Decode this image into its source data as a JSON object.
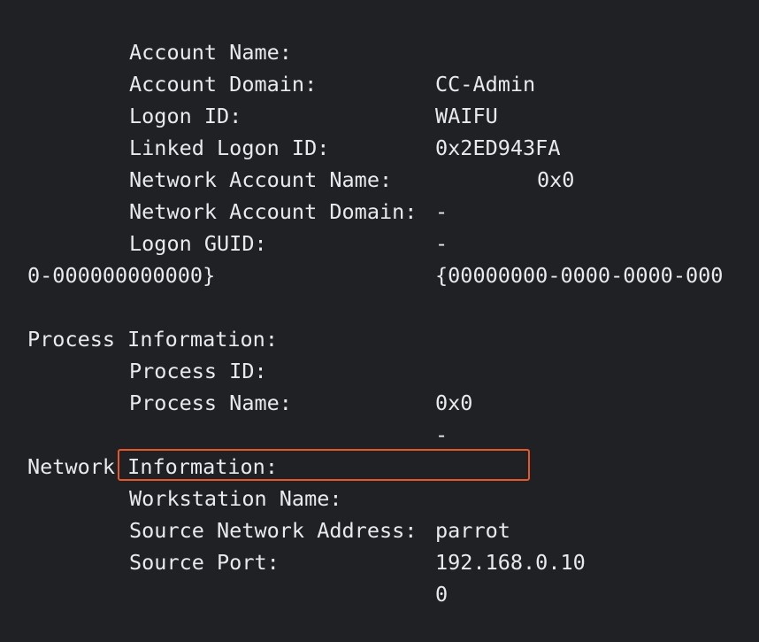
{
  "log": {
    "account_name": {
      "key": "Account Name:",
      "value": "CC-Admin"
    },
    "account_domain": {
      "key": "Account Domain:",
      "value": "WAIFU"
    },
    "logon_id": {
      "key": "Logon ID:",
      "value": "0x2ED943FA"
    },
    "linked_logon_id": {
      "key": "Linked Logon ID:",
      "value": "0x0"
    },
    "network_account_name": {
      "key": "Network Account Name:",
      "value": "-"
    },
    "network_account_domain": {
      "key": "Network Account Domain:",
      "value": "-"
    },
    "logon_guid": {
      "key": "Logon GUID:",
      "value": "{00000000-0000-0000-000",
      "value_cont": "0-000000000000}"
    },
    "process_information": {
      "header": "Process Information:"
    },
    "process_id": {
      "key": "Process ID:",
      "value": "0x0"
    },
    "process_name": {
      "key": "Process Name:",
      "value": "-"
    },
    "network_information": {
      "header": "Network Information:"
    },
    "workstation_name": {
      "key": "Workstation Name:",
      "value": "parrot"
    },
    "source_network_address": {
      "key": "Source Network Address:",
      "value": "192.168.0.10"
    },
    "source_port": {
      "key": "Source Port:",
      "value": "0"
    }
  },
  "colors": {
    "background": "#202124",
    "text": "#e8eaed",
    "highlight_border": "#e8572a"
  }
}
